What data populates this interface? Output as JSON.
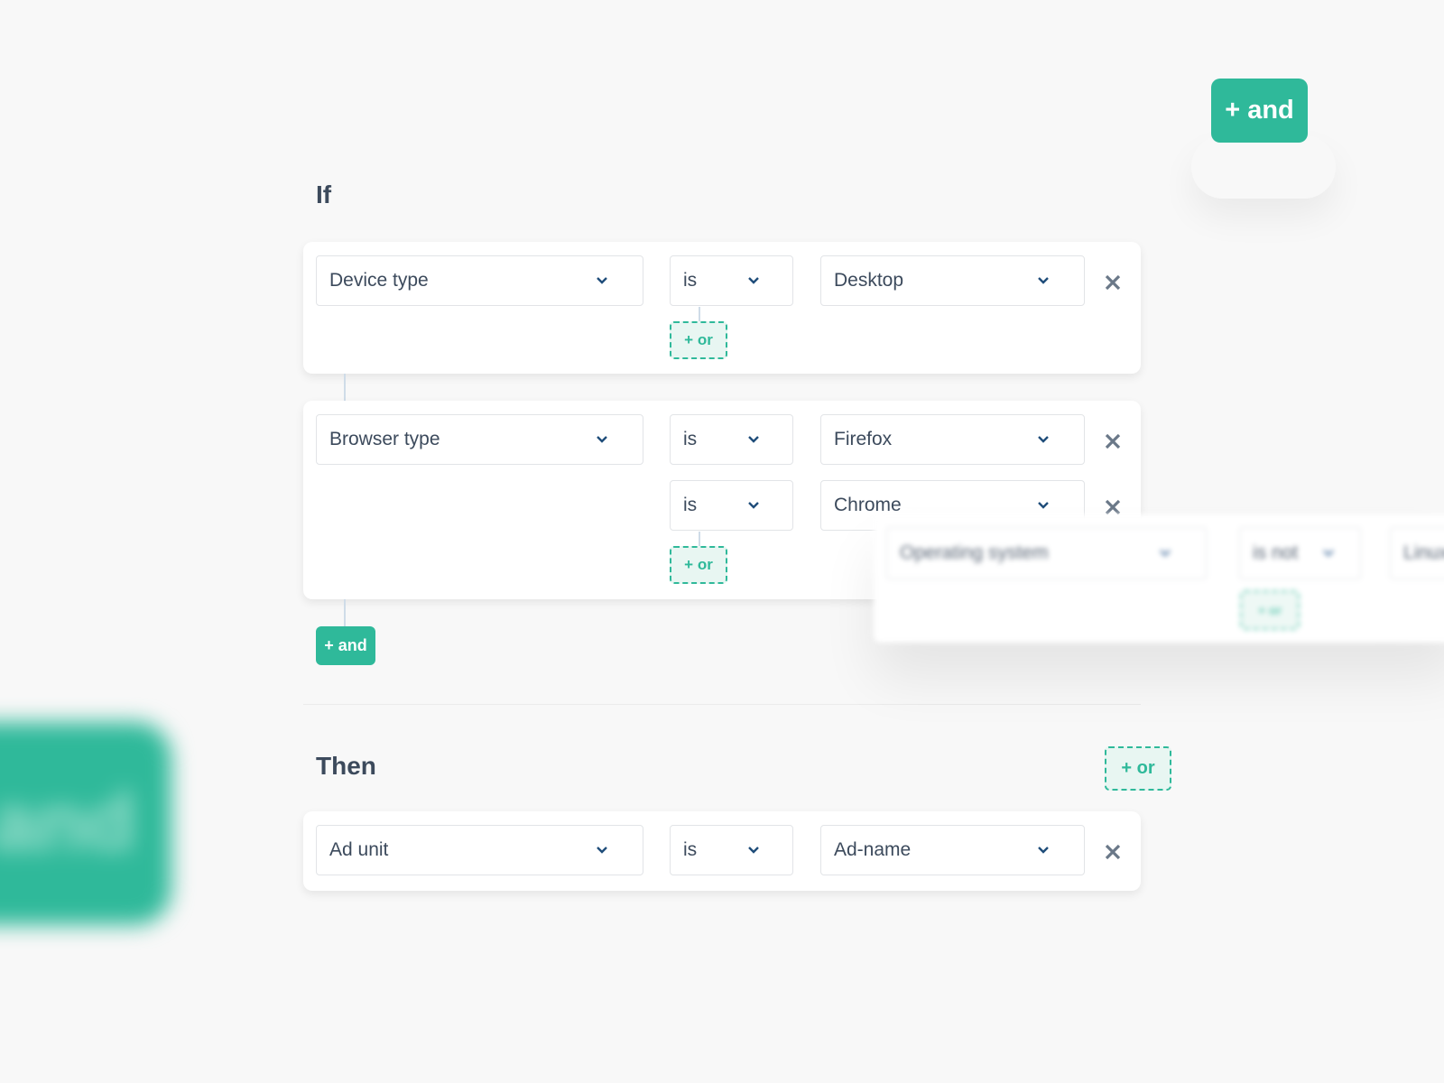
{
  "colors": {
    "accent": "#2fb99a",
    "text": "#3c4a5c",
    "chevron": "#1f4d7a",
    "close": "#6a7888",
    "background": "#f8f8f8"
  },
  "if_section": {
    "heading": "If",
    "conditions": [
      {
        "field": "Device type",
        "rows": [
          {
            "operator": "is",
            "value": "Desktop"
          }
        ],
        "or_label": "+ or"
      },
      {
        "field": "Browser type",
        "rows": [
          {
            "operator": "is",
            "value": "Firefox"
          },
          {
            "operator": "is",
            "value": "Chrome"
          }
        ],
        "or_label": "+ or"
      }
    ],
    "and_label": "+ and"
  },
  "then_section": {
    "heading": "Then",
    "conditions": [
      {
        "field": "Ad unit",
        "rows": [
          {
            "operator": "is",
            "value": "Ad-name"
          }
        ]
      }
    ]
  },
  "floating": {
    "top_and_label": "+ and",
    "then_or_label": "+ or",
    "blurred_card": {
      "field": "Operating system",
      "operator": "is not",
      "value": "Linux",
      "or_label": "+ or"
    },
    "blurred_and_label": "and"
  },
  "icons": {
    "chevron": "chevron-down-icon",
    "close": "close-icon"
  }
}
